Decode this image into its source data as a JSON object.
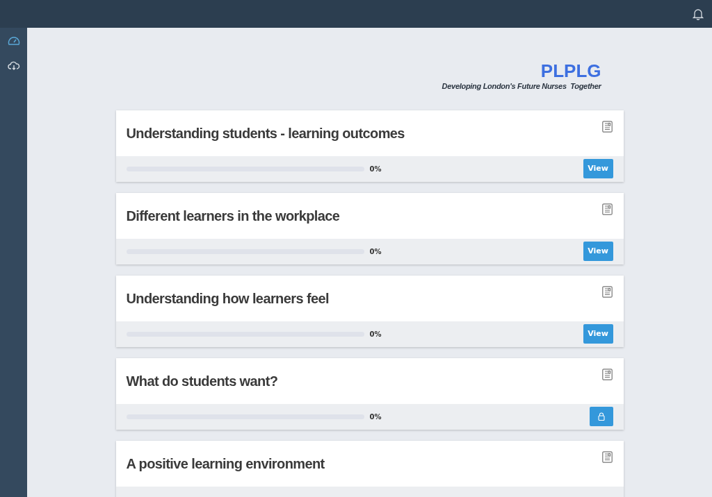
{
  "sidebar": {
    "items": [
      {
        "kind": "gauge",
        "selected": true
      },
      {
        "kind": "cloud",
        "selected": false
      }
    ]
  },
  "logo": {
    "title": "PLPLG",
    "tagline": "Developing London's Future Nurses  Together"
  },
  "modules": [
    {
      "title": "Understanding students - learning outcomes",
      "reading": "0%",
      "action": {
        "kind": "view",
        "label": "View"
      }
    },
    {
      "title": "Different learners in the workplace",
      "reading": "0%",
      "action": {
        "kind": "view",
        "label": "View"
      }
    },
    {
      "title": "Understanding how learners feel",
      "reading": "0%",
      "action": {
        "kind": "view",
        "label": "View"
      }
    },
    {
      "title": "What do students want?",
      "reading": "0%",
      "action": {
        "kind": "locked"
      }
    },
    {
      "title": "A positive learning environment"
    }
  ]
}
